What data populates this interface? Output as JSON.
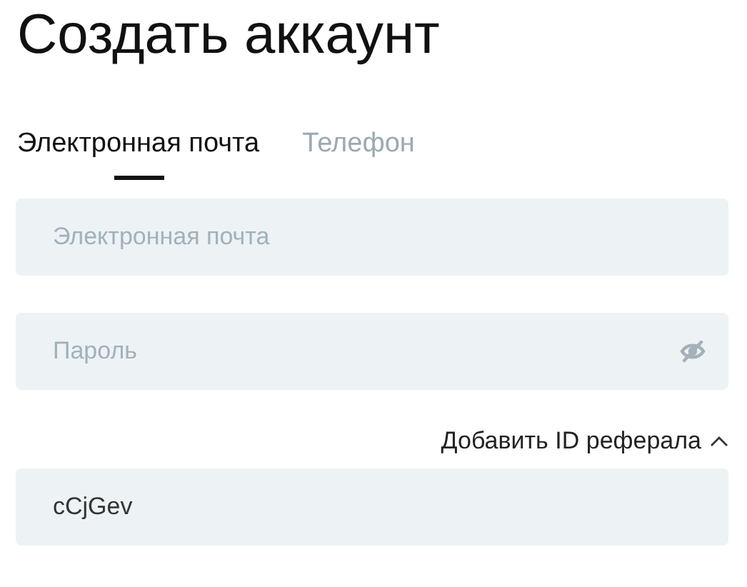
{
  "title": "Создать аккаунт",
  "tabs": [
    {
      "label": "Электронная почта",
      "selected": true
    },
    {
      "label": "Телефон",
      "selected": false
    }
  ],
  "email_field": {
    "placeholder": "Электронная почта"
  },
  "password_field": {
    "placeholder": "Пароль",
    "visible": false
  },
  "referral": {
    "label": "Добавить ID реферала",
    "expanded": true,
    "value": "cCjGev"
  }
}
